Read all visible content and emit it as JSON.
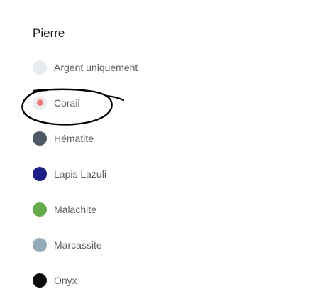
{
  "filter": {
    "title": "Pierre",
    "options": [
      {
        "label": "Argent uniquement",
        "color": "#e8ecee",
        "selected": false
      },
      {
        "label": "Corail",
        "color": "#f47a78",
        "selected": true
      },
      {
        "label": "Hématite",
        "color": "#4e5864",
        "selected": false
      },
      {
        "label": "Lapis Lazuli",
        "color": "#1b1f87",
        "selected": false
      },
      {
        "label": "Malachite",
        "color": "#65ad4a",
        "selected": false
      },
      {
        "label": "Marcassite",
        "color": "#94aab9",
        "selected": false
      },
      {
        "label": "Onyx",
        "color": "#0a0a0a",
        "selected": false
      }
    ]
  }
}
